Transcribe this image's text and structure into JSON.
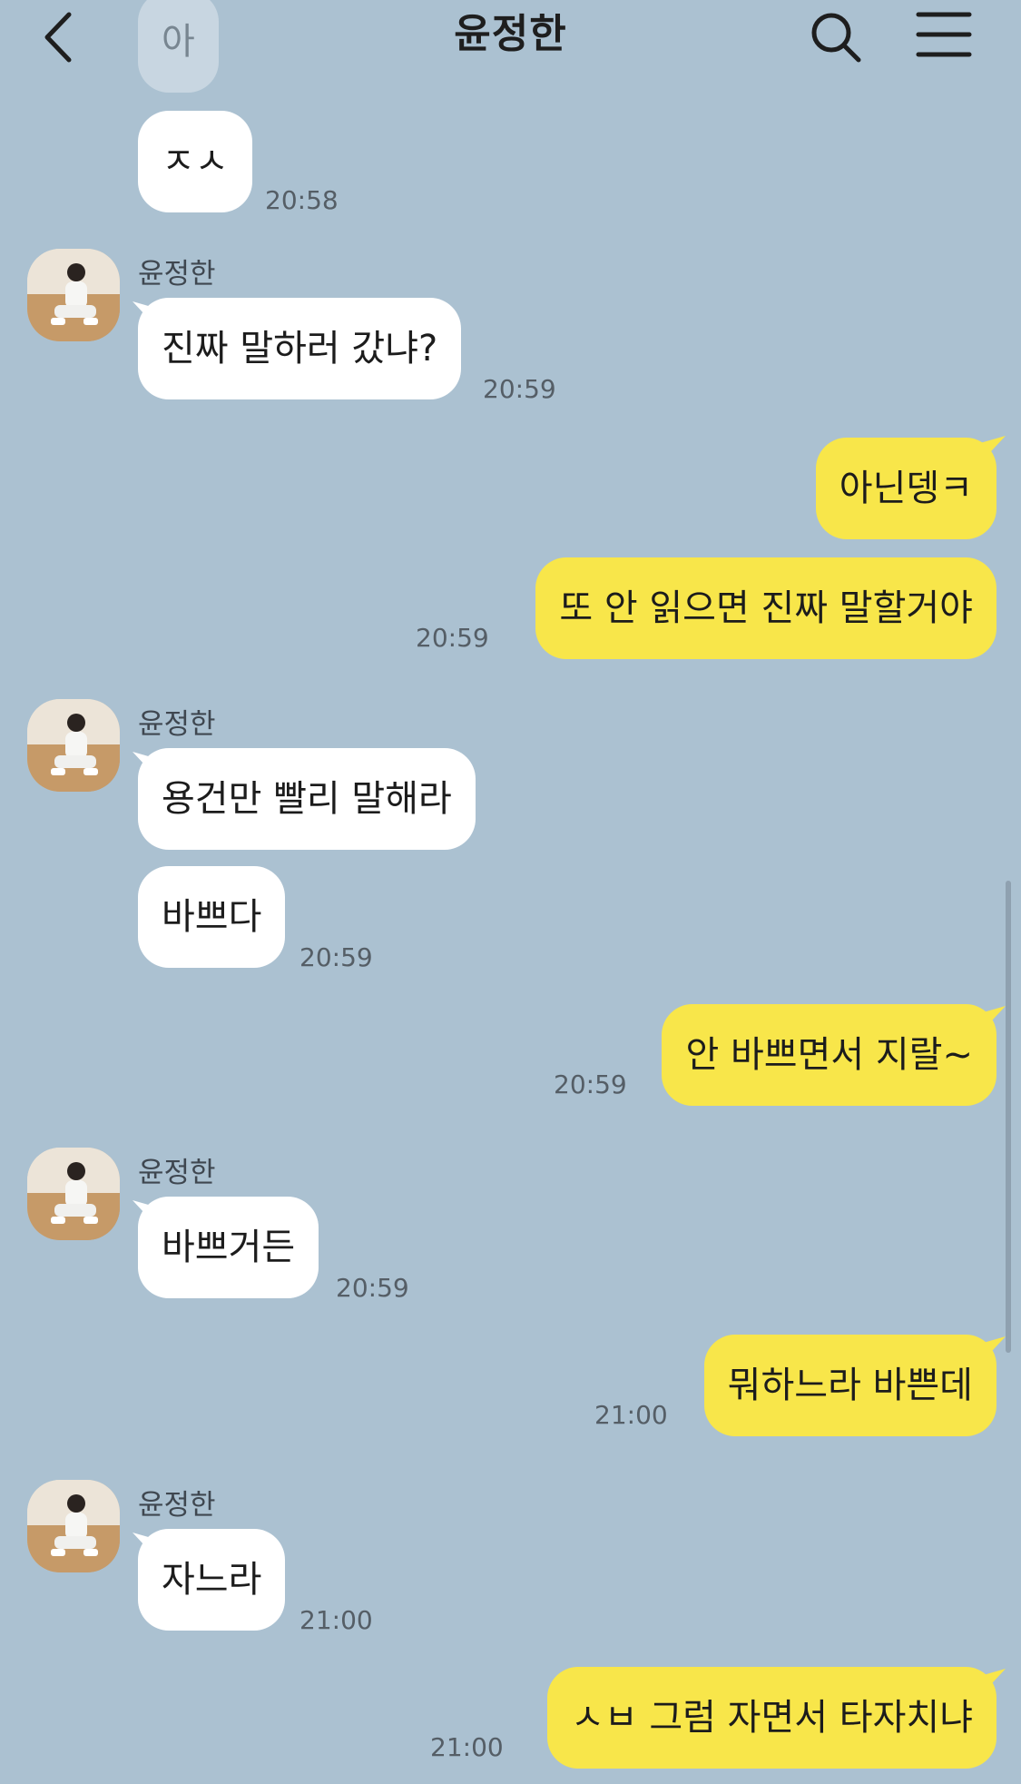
{
  "header": {
    "title": "윤정한",
    "back_icon": "chevron-left-icon",
    "search_icon": "search-icon",
    "menu_icon": "hamburger-menu-icon"
  },
  "sender_name": "윤정한",
  "messages": [
    {
      "text": "아"
    },
    {
      "text": "ㅈㅅ",
      "time": "20:58"
    },
    {
      "text": "진짜 말하러 갔냐?",
      "time": "20:59"
    },
    {
      "text": "아닌뎅ㅋ"
    },
    {
      "text": "또 안 읽으면 진짜 말할거야",
      "time": "20:59"
    },
    {
      "text": "용건만 빨리 말해라"
    },
    {
      "text": "바쁘다",
      "time": "20:59"
    },
    {
      "text": "안 바쁘면서 지랄~",
      "time": "20:59"
    },
    {
      "text": "바쁘거든",
      "time": "20:59"
    },
    {
      "text": "뭐하느라 바쁜데",
      "time": "21:00"
    },
    {
      "text": "자느라",
      "time": "21:00"
    },
    {
      "text": "ㅅㅂ 그럼 자면서 타자치냐",
      "time": "21:00"
    }
  ],
  "colors": {
    "background": "#abc1d1",
    "incoming_bubble": "#ffffff",
    "outgoing_bubble": "#f8e64a"
  }
}
